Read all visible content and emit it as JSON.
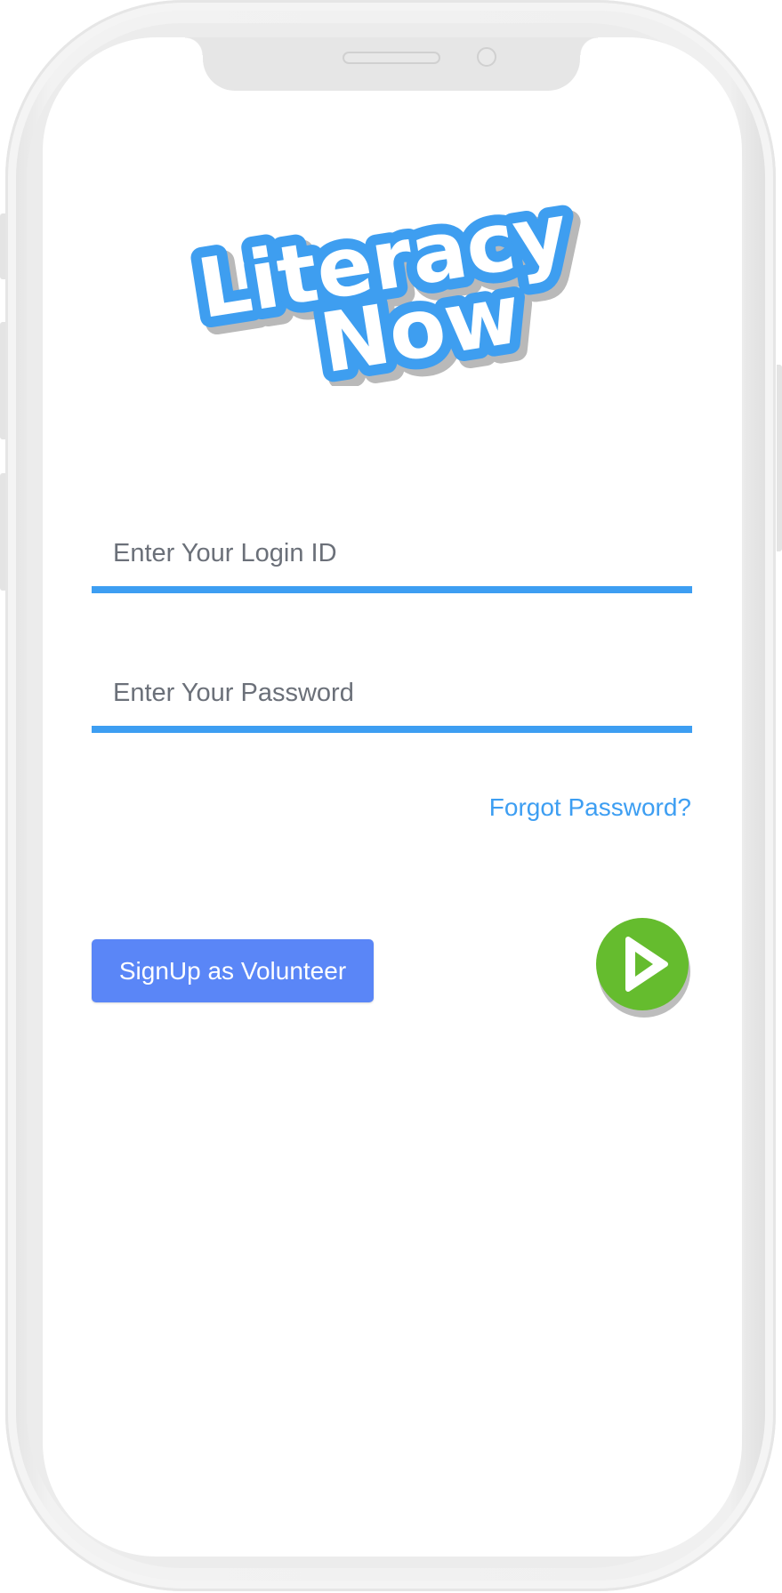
{
  "app": {
    "logo_line1": "Literacy",
    "logo_line2": "Now"
  },
  "login": {
    "login_id_placeholder": "Enter Your Login ID",
    "login_id_value": "",
    "password_placeholder": "Enter Your Password",
    "password_value": "",
    "forgot_label": "Forgot Password?",
    "signup_label": "SignUp as Volunteer",
    "go_icon": "play-icon"
  },
  "colors": {
    "accent_blue": "#3d9ef2",
    "signup_blue": "#5a86f7",
    "go_green": "#65bc2e"
  }
}
